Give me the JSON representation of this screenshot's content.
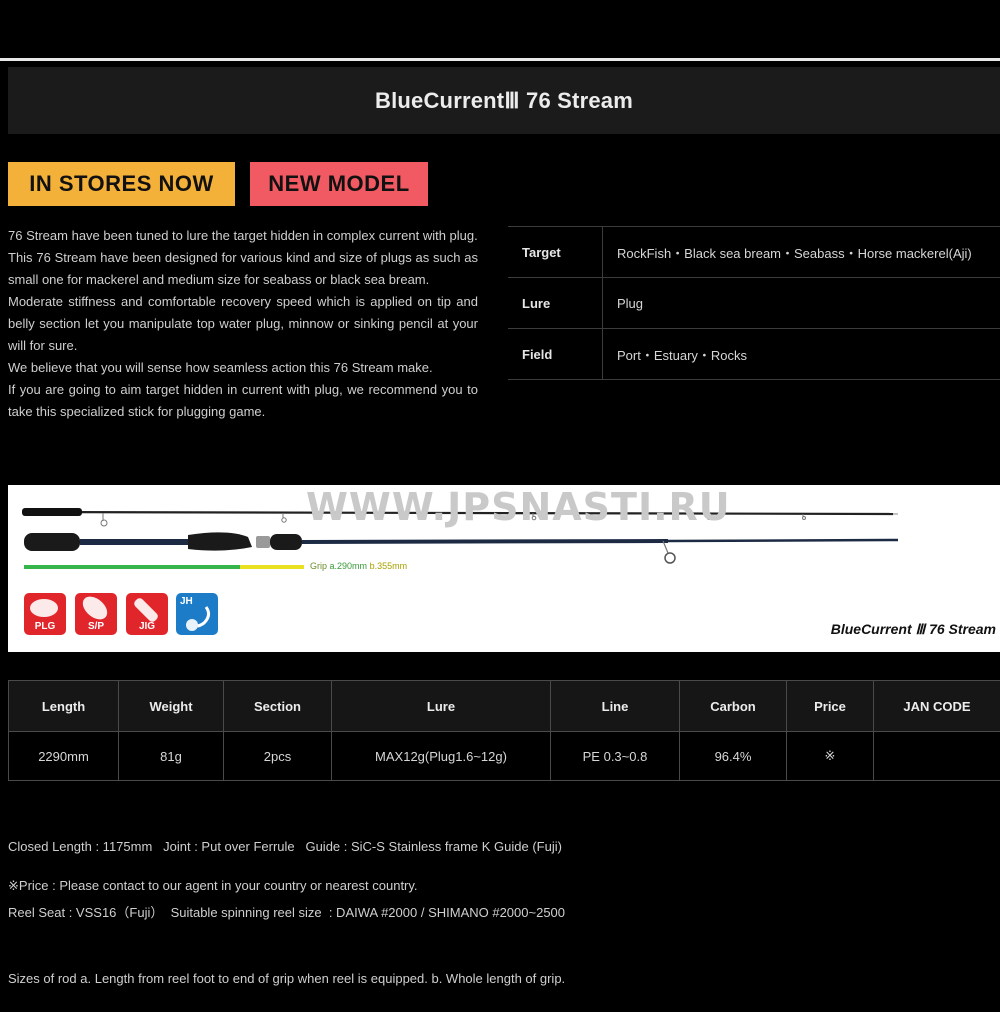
{
  "header": {
    "title": "BlueCurrentⅢ 76 Stream"
  },
  "badges": {
    "in_stores": "IN STORES NOW",
    "new_model": "NEW MODEL"
  },
  "description": [
    "76 Stream have been tuned to lure the target hidden in complex current with plug.",
    "This 76 Stream have been designed for various kind and size of plugs as such as small one for mackerel and medium size for seabass or black sea bream.",
    "Moderate stiffness and comfortable recovery speed which is applied on tip and belly section let you manipulate top water plug, minnow or sinking pencil at your will for sure.",
    "We believe that you will sense how seamless action this 76 Stream make.",
    "If you are going to aim target hidden in current with plug, we recommend you to take this specialized stick for plugging game."
  ],
  "spec": {
    "target_label": "Target",
    "target_value": "RockFish・Black sea bream・Seabass・Horse mackerel(Aji)",
    "lure_label": "Lure",
    "lure_value": "Plug",
    "field_label": "Field",
    "field_value": "Port・Estuary・Rocks"
  },
  "product_image": {
    "watermark": "WWW.JPSNASTI.RU",
    "grip_prefix": "Grip ",
    "grip_a": "a.290mm",
    "grip_b": "b.355mm",
    "icons": [
      "PLG",
      "S/P",
      "JIG",
      "JH"
    ],
    "name": "BlueCurrent Ⅲ 76 Stream",
    "colors": {
      "grip_a": "#36b54a",
      "grip_b": "#e9e11f",
      "lure_red": "#e0262b",
      "jh_blue": "#1c7cc7"
    }
  },
  "table": {
    "headers": [
      "Length",
      "Weight",
      "Section",
      "Lure",
      "Line",
      "Carbon",
      "Price",
      "JAN CODE"
    ],
    "row": [
      "2290mm",
      "81g",
      "2pcs",
      "MAX12g(Plug1.6~12g)",
      "PE 0.3~0.8",
      "96.4%",
      "※",
      ""
    ]
  },
  "notes": {
    "line1": "Closed Length : 1175mm   Joint : Put over Ferrule   Guide : SiC-S Stainless frame K Guide (Fuji)",
    "line2": "Reel Seat : VSS16（Fuji）  Suitable spinning reel size  : DAIWA #2000 / SHIMANO #2000~2500",
    "line3": "Sizes of rod a. Length from reel foot to end of grip when reel is equipped. b. Whole length of grip.",
    "price": "※Price : Please contact to our agent in your country or nearest country."
  }
}
